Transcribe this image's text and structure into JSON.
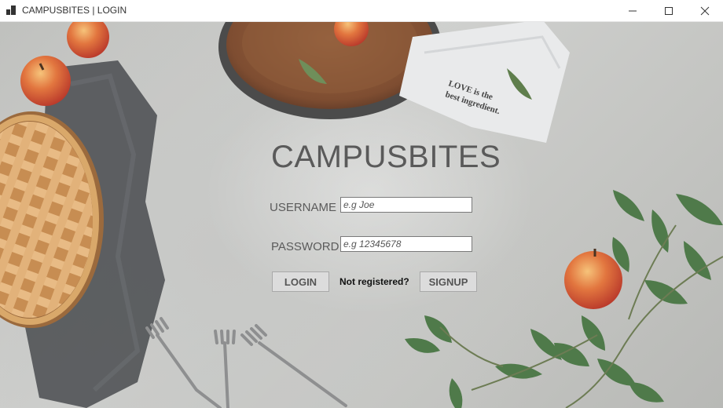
{
  "window": {
    "title": "CAMPUSBITES | LOGIN",
    "controls": {
      "minimize": "minimize",
      "maximize": "maximize",
      "close": "close"
    }
  },
  "background": {
    "towel_text_line1": "LOVE is the",
    "towel_text_line2": "best ingredient.",
    "colors": {
      "surface": "#c6c7c4",
      "plate": "#8a5a3c",
      "apple": "#d9553a",
      "leaf": "#4f7a4a"
    }
  },
  "form": {
    "title": "CAMPUSBITES",
    "username_label": "USERNAME",
    "username_placeholder": "e.g Joe",
    "username_value": "",
    "password_label": "PASSWORD",
    "password_placeholder": "e.g 12345678",
    "password_value": "",
    "login_label": "LOGIN",
    "not_registered": "Not registered?",
    "signup_label": "SIGNUP"
  }
}
